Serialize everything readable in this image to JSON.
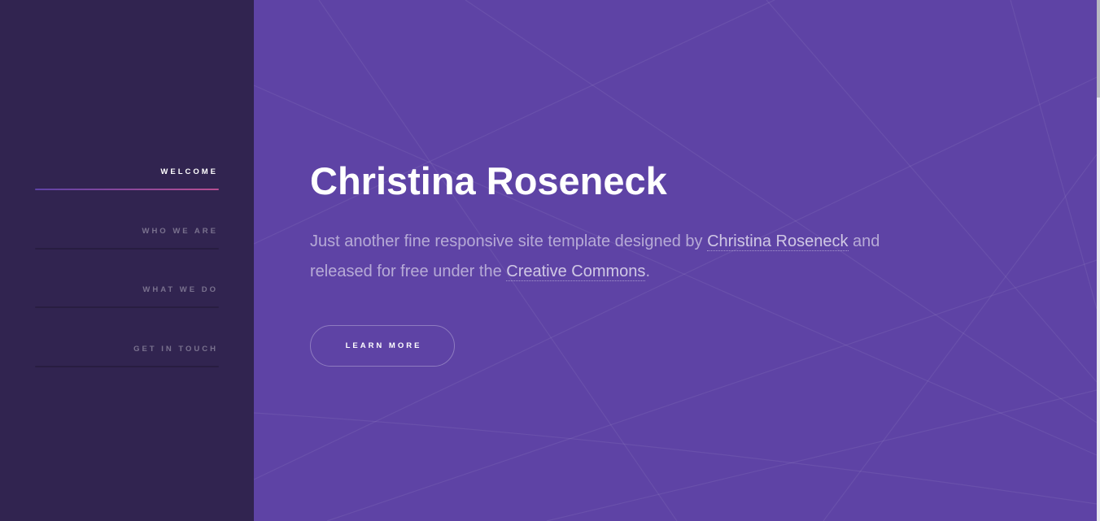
{
  "sidebar": {
    "items": [
      {
        "label": "WELCOME",
        "active": true
      },
      {
        "label": "WHO WE ARE",
        "active": false
      },
      {
        "label": "WHAT WE DO",
        "active": false
      },
      {
        "label": "GET IN TOUCH",
        "active": false
      }
    ]
  },
  "hero": {
    "title": "Christina Roseneck",
    "text_1": "Just another fine responsive site template designed by ",
    "link_author": "Christina Roseneck",
    "text_2": " and released for free under the ",
    "link_license": "Creative Commons",
    "text_3": ".",
    "button_label": "LEARN MORE"
  },
  "colors": {
    "sidebar_bg": "#312450",
    "main_bg": "#5e43a5",
    "active_gradient_start": "#5e42a6",
    "active_gradient_end": "#b74e91"
  }
}
